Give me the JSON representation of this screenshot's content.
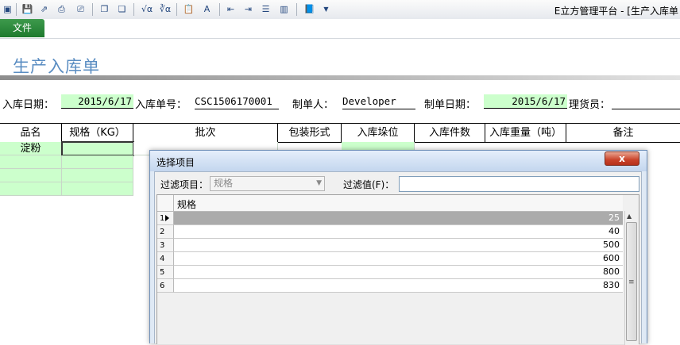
{
  "app": {
    "title": "E立方管理平台 - [生产入库单"
  },
  "menu": {
    "file_label": "文件"
  },
  "toolbar": {
    "icons": [
      "save-icon",
      "save-as-icon",
      "preview-icon",
      "print-icon",
      "copy-icon",
      "paste-icon",
      "formula-icon",
      "formula-edit-icon",
      "clipboard-icon",
      "text-icon",
      "align-left-icon",
      "align-right-icon",
      "sort-icon",
      "column-icon",
      "book-icon",
      "dropdown-icon"
    ]
  },
  "form": {
    "title": "生产入库单",
    "fields": {
      "in_date_label": "入库日期：",
      "in_date_value": "2015/6/17",
      "doc_no_label": "入库单号：",
      "doc_no_value": "CSC1506170001",
      "maker_label": "制单人：",
      "maker_value": "Developer",
      "make_date_label": "制单日期：",
      "make_date_value": "2015/6/17",
      "keeper_label": "理货员：",
      "keeper_value": ""
    }
  },
  "grid": {
    "columns": [
      "品名",
      "规格（KG）",
      "批次",
      "包装形式",
      "入库垛位",
      "入库件数",
      "入库重量（吨）",
      "备注"
    ],
    "rows": [
      {
        "name": "淀粉"
      }
    ]
  },
  "dialog": {
    "title": "选择项目",
    "close_label": "x",
    "filter_item_label": "过滤项目：",
    "filter_item_value": "规格",
    "filter_value_label": "过滤值(F)：",
    "filter_value_input": "",
    "list_header": "规格",
    "rows": [
      {
        "index": "1",
        "value": "25",
        "selected": true
      },
      {
        "index": "2",
        "value": "40",
        "selected": false
      },
      {
        "index": "3",
        "value": "500",
        "selected": false
      },
      {
        "index": "4",
        "value": "600",
        "selected": false
      },
      {
        "index": "5",
        "value": "800",
        "selected": false
      },
      {
        "index": "6",
        "value": "830",
        "selected": false
      }
    ]
  }
}
